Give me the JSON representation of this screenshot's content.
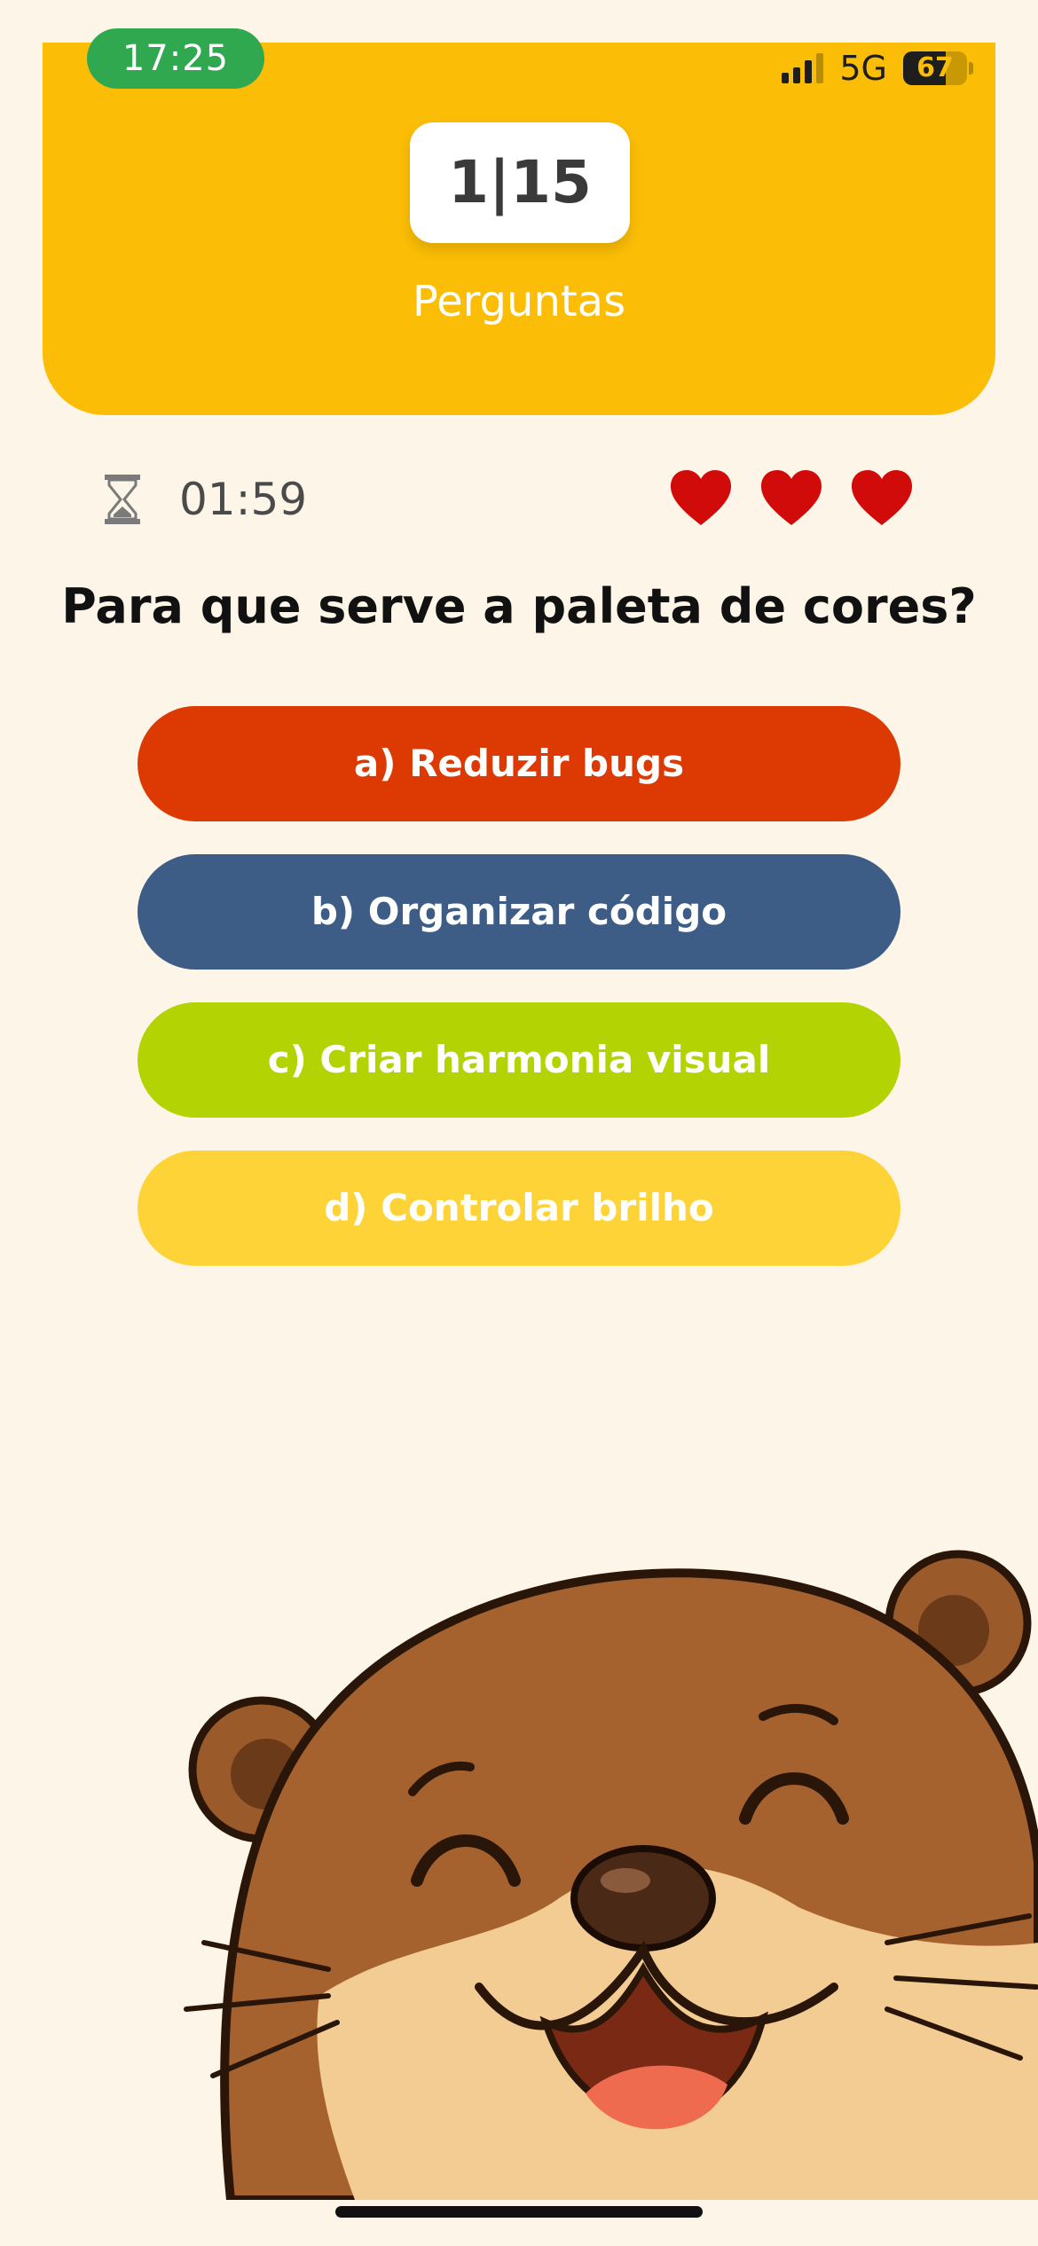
{
  "status_bar": {
    "time": "17:25",
    "network": "5G",
    "battery": "67"
  },
  "header": {
    "counter": "1|15",
    "subtitle": "Perguntas",
    "background_color": "#fbbd05"
  },
  "timer": {
    "icon": "hourglass-icon",
    "value": "01:59"
  },
  "lives": {
    "icon": "heart-icon",
    "count": 3,
    "color": "#d10a0a"
  },
  "question": {
    "text": "Para que serve a paleta de cores?"
  },
  "answers": [
    {
      "label": "a) Reduzir bugs",
      "color": "#dc3a02"
    },
    {
      "label": "b) Organizar código",
      "color": "#3d5d87"
    },
    {
      "label": "c) Criar harmonia visual",
      "color": "#b4d303"
    },
    {
      "label": "d) Controlar brilho",
      "color": "#fed337"
    }
  ],
  "mascot": {
    "icon": "otter-mascot-illustration"
  }
}
